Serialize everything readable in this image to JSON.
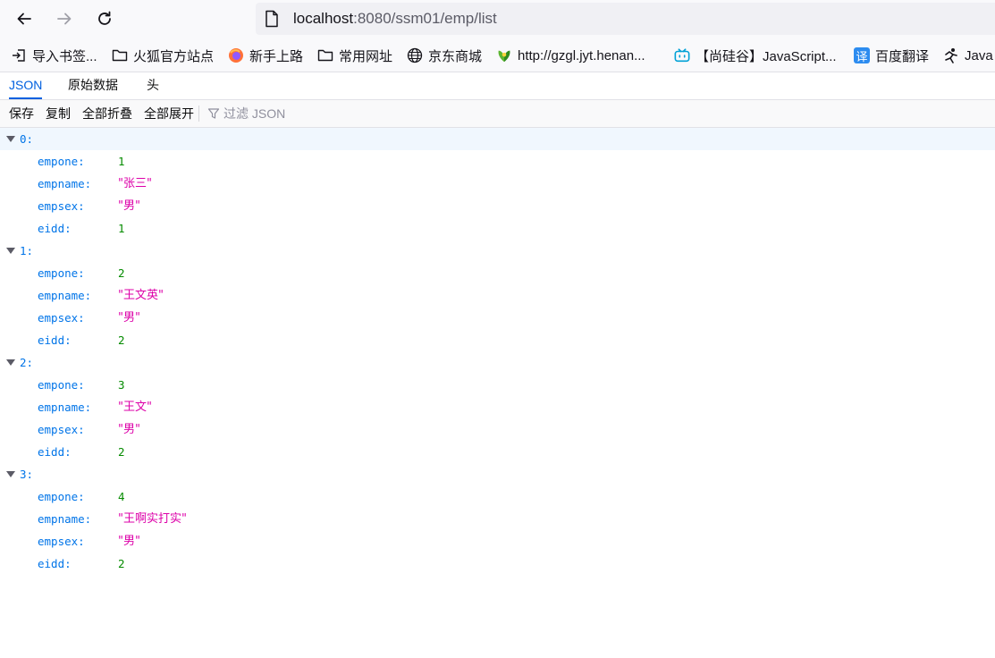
{
  "nav": {
    "url_host": "localhost",
    "url_rest": ":8080/ssm01/emp/list"
  },
  "bookmarks": [
    {
      "label": "导入书签...",
      "icon": "import-icon"
    },
    {
      "label": "火狐官方站点",
      "icon": "folder-icon"
    },
    {
      "label": "新手上路",
      "icon": "firefox-icon"
    },
    {
      "label": "常用网址",
      "icon": "folder-icon"
    },
    {
      "label": "京东商城",
      "icon": "globe-icon"
    },
    {
      "label": "http://gzgl.jyt.henan...",
      "icon": "site-icon"
    },
    {
      "label": "【尚硅谷】JavaScript...",
      "icon": "bilibili-icon"
    },
    {
      "label": "百度翻译",
      "icon": "translate-icon"
    },
    {
      "label": "Java",
      "icon": "runner-icon"
    }
  ],
  "tabs": [
    "JSON",
    "原始数据",
    "头"
  ],
  "toolbar": {
    "save": "保存",
    "copy": "复制",
    "collapse_all": "全部折叠",
    "expand_all": "全部展开",
    "filter_placeholder": "过滤 JSON"
  },
  "json_data": [
    {
      "index": "0:",
      "fields": [
        {
          "key": "empone:",
          "value": "1",
          "type": "num"
        },
        {
          "key": "empname:",
          "value": "\"张三\"",
          "type": "str"
        },
        {
          "key": "empsex:",
          "value": "\"男\"",
          "type": "str"
        },
        {
          "key": "eidd:",
          "value": "1",
          "type": "num"
        }
      ]
    },
    {
      "index": "1:",
      "fields": [
        {
          "key": "empone:",
          "value": "2",
          "type": "num"
        },
        {
          "key": "empname:",
          "value": "\"王文英\"",
          "type": "str"
        },
        {
          "key": "empsex:",
          "value": "\"男\"",
          "type": "str"
        },
        {
          "key": "eidd:",
          "value": "2",
          "type": "num"
        }
      ]
    },
    {
      "index": "2:",
      "fields": [
        {
          "key": "empone:",
          "value": "3",
          "type": "num"
        },
        {
          "key": "empname:",
          "value": "\"王文\"",
          "type": "str"
        },
        {
          "key": "empsex:",
          "value": "\"男\"",
          "type": "str"
        },
        {
          "key": "eidd:",
          "value": "2",
          "type": "num"
        }
      ]
    },
    {
      "index": "3:",
      "fields": [
        {
          "key": "empone:",
          "value": "4",
          "type": "num"
        },
        {
          "key": "empname:",
          "value": "\"王啊实打实\"",
          "type": "str"
        },
        {
          "key": "empsex:",
          "value": "\"男\"",
          "type": "str"
        },
        {
          "key": "eidd:",
          "value": "2",
          "type": "num"
        }
      ]
    }
  ],
  "colors": {
    "accent": "#0060df",
    "key": "#0074e8",
    "number": "#058b00",
    "string": "#dd00a9"
  }
}
